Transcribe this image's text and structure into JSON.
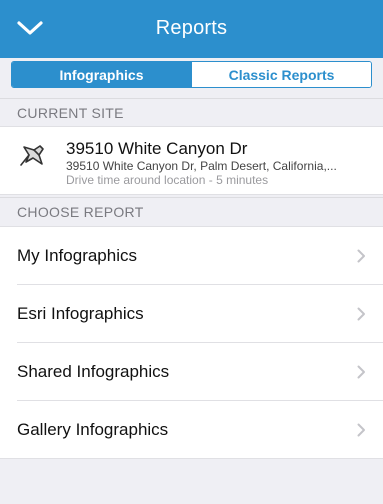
{
  "header": {
    "title": "Reports",
    "back_icon": "chevron-down-icon",
    "color": "#2c8fcd"
  },
  "tabs": [
    {
      "label": "Infographics",
      "active": true
    },
    {
      "label": "Classic Reports",
      "active": false
    }
  ],
  "current_site": {
    "section_label": "CURRENT SITE",
    "icon": "location-pin-icon",
    "name": "39510 White Canyon Dr",
    "address": "39510 White Canyon Dr, Palm Desert, California,...",
    "drive_time": "Drive time around location - 5 minutes"
  },
  "choose_report": {
    "section_label": "CHOOSE REPORT",
    "items": [
      {
        "label": "My Infographics"
      },
      {
        "label": "Esri Infographics"
      },
      {
        "label": "Shared Infographics"
      },
      {
        "label": "Gallery Infographics"
      }
    ]
  }
}
